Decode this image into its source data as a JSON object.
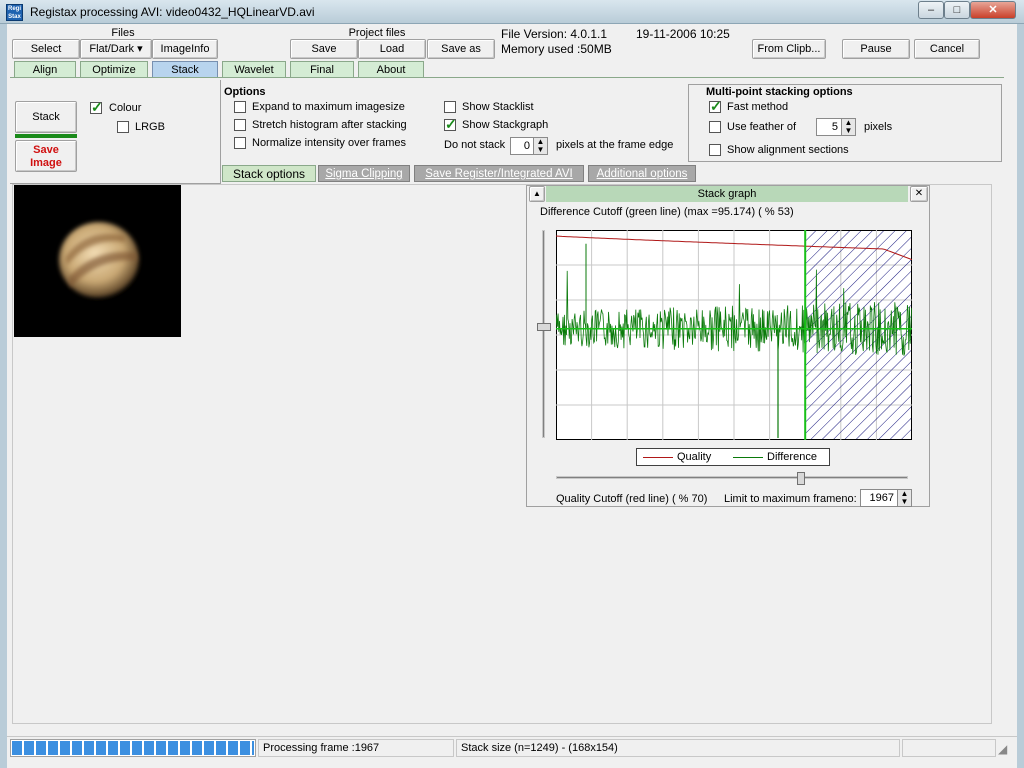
{
  "window": {
    "icon_text": "Regi Stax",
    "title": "Registax processing AVI: video0432_HQLinearVD.avi",
    "min": "–",
    "max": "□",
    "close": "✕"
  },
  "toolbar": {
    "files_group": "Files",
    "project_files_group": "Project files",
    "select": "Select",
    "flat_dark": "Flat/Dark ▾",
    "imageinfo": "ImageInfo",
    "save": "Save",
    "load": "Load",
    "save_as": "Save as",
    "file_version": "File Version: 4.0.1.1",
    "date": "19-11-2006 10:25",
    "memory": "Memory used :50MB",
    "from_clipb": "From Clipb...",
    "pause": "Pause",
    "cancel": "Cancel"
  },
  "tabs": [
    "Align",
    "Optimize",
    "Stack",
    "Wavelet",
    "Final",
    "About"
  ],
  "left_panel": {
    "stack_button": "Stack",
    "save_image_line1": "Save",
    "save_image_line2": "Image",
    "colour": "Colour",
    "lrgb": "LRGB"
  },
  "options": {
    "heading": "Options",
    "expand": "Expand to maximum imagesize",
    "stretch": "Stretch histogram after stacking",
    "normalize": "Normalize intensity over frames",
    "show_stacklist": "Show Stacklist",
    "show_stackgraph": "Show Stackgraph",
    "do_not_stack": "Do not stack",
    "do_not_stack_value": "0",
    "pixels_edge": "pixels at the frame edge"
  },
  "multipoint": {
    "heading": "Multi-point stacking options",
    "fast_method": "Fast method",
    "use_feather": "Use feather of",
    "feather_value": "5",
    "pixels": "pixels",
    "show_alignment": "Show alignment sections"
  },
  "subtabs": [
    "Stack  options",
    "Sigma Clipping",
    "Save Register/Integrated AVI",
    "Additional options"
  ],
  "stack_graph": {
    "title": "Stack graph",
    "collapse": "▲",
    "close": "✕",
    "diff_cutoff": "Difference Cutoff (green line) (max =95.174) ( % 53)",
    "quality_cutoff": "Quality Cutoff (red line) ( % 70)",
    "limit_label": "Limit to maximum frameno:",
    "limit_value": "1967",
    "legend_quality": "Quality",
    "legend_difference": "Difference"
  },
  "statusbar": {
    "processing": "Processing frame :1967",
    "stack_size": "Stack size (n=1249) - (168x154)",
    "progress": 1.0
  },
  "colors": {
    "quality_line": "#b01818",
    "difference_line": "#0a7a0a",
    "cutoff_hatch": "#1a1a80",
    "progress": "#3b8fe0"
  },
  "chart_data": {
    "type": "line",
    "series": [
      {
        "name": "Quality",
        "color": "#b01818"
      },
      {
        "name": "Difference",
        "color": "#0a7a0a"
      }
    ],
    "difference_cutoff_percent": 53,
    "difference_max": 95.174,
    "quality_cutoff_percent": 70,
    "max_frameno": 1967
  }
}
